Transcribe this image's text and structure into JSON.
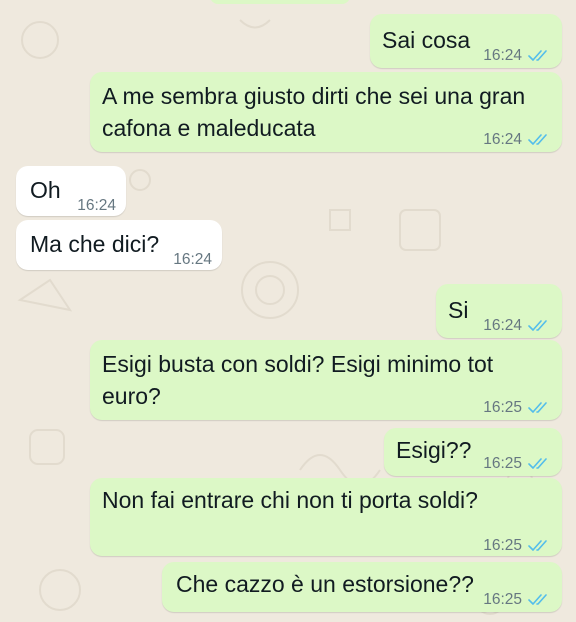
{
  "chat": {
    "messages": [
      {
        "direction": "outgoing",
        "text": "Sai cosa",
        "time": "16:24",
        "status": "read-icon"
      },
      {
        "direction": "outgoing",
        "text": "A me sembra giusto dirti che sei una gran\ncafona e maleducata",
        "time": "16:24",
        "status": "read-icon"
      },
      {
        "direction": "incoming",
        "text": "Oh",
        "time": "16:24"
      },
      {
        "direction": "incoming",
        "text": "Ma che dici?",
        "time": "16:24"
      },
      {
        "direction": "outgoing",
        "text": "Si",
        "time": "16:24",
        "status": "read-icon"
      },
      {
        "direction": "outgoing",
        "text": "Esigi busta con soldi? Esigi minimo tot\neuro?",
        "time": "16:25",
        "status": "read-icon"
      },
      {
        "direction": "outgoing",
        "text": "Esigi??",
        "time": "16:25",
        "status": "read-icon"
      },
      {
        "direction": "outgoing",
        "text": "Non fai entrare chi non ti porta soldi?",
        "time": "16:25",
        "status": "read-icon"
      },
      {
        "direction": "outgoing",
        "text": "Che cazzo è un estorsione??",
        "time": "16:25",
        "status": "read-icon"
      }
    ]
  },
  "colors": {
    "outgoing_bubble": "#dcf8c6",
    "incoming_bubble": "#ffffff",
    "background": "#efe9de",
    "read_ticks": "#53bdeb",
    "timestamp": "#667781"
  }
}
